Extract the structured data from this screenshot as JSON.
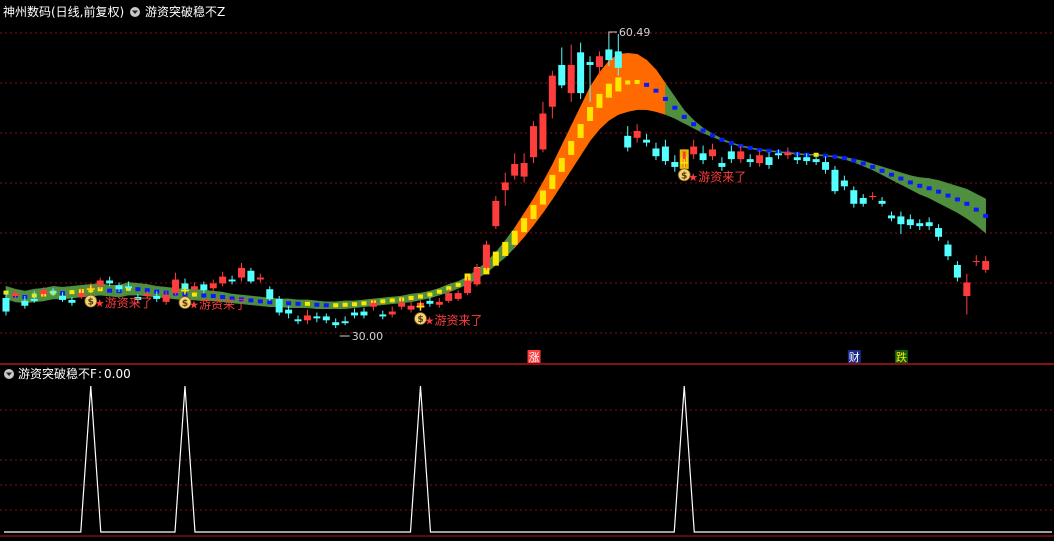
{
  "main_panel": {
    "stock_title": "神州数码(日线,前复权)",
    "indicator_title": "游资突破稳不Z",
    "signal_label": "游资来了",
    "high_label": "60.49",
    "low_label": "30.00",
    "markers": [
      "涨",
      "财",
      "跌"
    ]
  },
  "sub_panel": {
    "indicator_title": "游资突破稳不F",
    "indicator_value": "0.00"
  },
  "colors": {
    "up": "#ff3d3d",
    "down": "#54ffff",
    "band_hot": "#ff6a00",
    "band_cool": "#4f8f3f",
    "dash_hot": "#ffe600",
    "dash_cool": "#0a1aff",
    "signal_text": "#ff3d3d",
    "grid": "#8a1010"
  },
  "chart_data": [
    {
      "type": "candlestick",
      "price_high": 60.49,
      "price_low": 30.0,
      "candles": [
        {
          "o": 33.3,
          "c": 31.9,
          "h": 34.0,
          "l": 31.5
        },
        {
          "o": 33.5,
          "c": 33.8,
          "h": 34.1,
          "l": 33.2
        },
        {
          "o": 33.0,
          "c": 32.5,
          "h": 33.5,
          "l": 32.2
        },
        {
          "o": 33.2,
          "c": 33.0,
          "h": 34.0,
          "l": 32.8
        },
        {
          "o": 33.7,
          "c": 34.1,
          "h": 34.4,
          "l": 33.4
        },
        {
          "o": 34.0,
          "c": 33.8,
          "h": 34.3,
          "l": 33.5
        },
        {
          "o": 33.5,
          "c": 33.1,
          "h": 33.9,
          "l": 32.9
        },
        {
          "o": 33.1,
          "c": 32.8,
          "h": 33.4,
          "l": 32.5
        },
        {
          "o": 33.4,
          "c": 33.8,
          "h": 34.3,
          "l": 33.2
        },
        {
          "o": 34.1,
          "c": 34.4,
          "h": 34.8,
          "l": 33.8
        },
        {
          "o": 34.6,
          "c": 35.1,
          "h": 35.4,
          "l": 34.2
        },
        {
          "o": 35.1,
          "c": 34.8,
          "h": 35.5,
          "l": 34.5
        },
        {
          "o": 34.6,
          "c": 34.2,
          "h": 34.9,
          "l": 33.9
        },
        {
          "o": 34.5,
          "c": 34.3,
          "h": 35.0,
          "l": 34.0
        },
        {
          "o": 33.4,
          "c": 33.1,
          "h": 33.7,
          "l": 32.8
        },
        {
          "o": 33.5,
          "c": 33.7,
          "h": 34.0,
          "l": 33.2
        },
        {
          "o": 33.5,
          "c": 33.2,
          "h": 34.0,
          "l": 32.9
        },
        {
          "o": 32.9,
          "c": 33.6,
          "h": 34.0,
          "l": 32.6
        },
        {
          "o": 33.8,
          "c": 35.2,
          "h": 35.9,
          "l": 33.6
        },
        {
          "o": 34.8,
          "c": 34.2,
          "h": 35.3,
          "l": 33.9
        },
        {
          "o": 34.2,
          "c": 34.5,
          "h": 34.9,
          "l": 33.9
        },
        {
          "o": 34.7,
          "c": 34.1,
          "h": 35.0,
          "l": 33.8
        },
        {
          "o": 34.3,
          "c": 34.8,
          "h": 35.2,
          "l": 34.0
        },
        {
          "o": 34.8,
          "c": 35.5,
          "h": 36.0,
          "l": 34.5
        },
        {
          "o": 35.2,
          "c": 35.0,
          "h": 35.6,
          "l": 34.7
        },
        {
          "o": 35.4,
          "c": 36.4,
          "h": 36.9,
          "l": 35.0
        },
        {
          "o": 36.1,
          "c": 35.0,
          "h": 36.4,
          "l": 34.8
        },
        {
          "o": 35.2,
          "c": 35.4,
          "h": 35.8,
          "l": 34.9
        },
        {
          "o": 34.2,
          "c": 33.2,
          "h": 34.5,
          "l": 33.0
        },
        {
          "o": 33.2,
          "c": 31.8,
          "h": 33.5,
          "l": 31.5
        },
        {
          "o": 32.1,
          "c": 31.7,
          "h": 32.5,
          "l": 31.2
        },
        {
          "o": 31.1,
          "c": 30.9,
          "h": 31.5,
          "l": 30.6
        },
        {
          "o": 31.0,
          "c": 31.5,
          "h": 32.1,
          "l": 30.6
        },
        {
          "o": 31.4,
          "c": 31.2,
          "h": 31.8,
          "l": 30.8
        },
        {
          "o": 31.4,
          "c": 31.0,
          "h": 31.7,
          "l": 30.7
        },
        {
          "o": 30.8,
          "c": 30.5,
          "h": 31.2,
          "l": 30.2
        },
        {
          "o": 30.9,
          "c": 30.7,
          "h": 31.4,
          "l": 30.5
        },
        {
          "o": 31.8,
          "c": 31.5,
          "h": 32.2,
          "l": 31.2
        },
        {
          "o": 31.9,
          "c": 31.5,
          "h": 32.3,
          "l": 31.2
        },
        {
          "o": 32.4,
          "c": 32.8,
          "h": 33.2,
          "l": 32.0
        },
        {
          "o": 31.6,
          "c": 31.4,
          "h": 32.0,
          "l": 31.1
        },
        {
          "o": 31.6,
          "c": 31.9,
          "h": 32.4,
          "l": 31.3
        },
        {
          "o": 32.4,
          "c": 32.8,
          "h": 33.3,
          "l": 32.1
        },
        {
          "o": 32.1,
          "c": 32.5,
          "h": 33.0,
          "l": 31.8
        },
        {
          "o": 32.3,
          "c": 32.8,
          "h": 33.1,
          "l": 32.0
        },
        {
          "o": 33.0,
          "c": 32.7,
          "h": 33.4,
          "l": 32.4
        },
        {
          "o": 32.6,
          "c": 32.9,
          "h": 33.3,
          "l": 32.3
        },
        {
          "o": 33.0,
          "c": 33.8,
          "h": 34.2,
          "l": 32.8
        },
        {
          "o": 33.2,
          "c": 33.8,
          "h": 34.1,
          "l": 33.0
        },
        {
          "o": 33.8,
          "c": 35.1,
          "h": 35.5,
          "l": 33.6
        },
        {
          "o": 34.7,
          "c": 36.4,
          "h": 36.8,
          "l": 34.5
        },
        {
          "o": 36.4,
          "c": 38.8,
          "h": 39.2,
          "l": 36.2
        },
        {
          "o": 40.7,
          "c": 43.3,
          "h": 43.8,
          "l": 40.4
        },
        {
          "o": 44.4,
          "c": 45.2,
          "h": 46.2,
          "l": 42.8
        },
        {
          "o": 45.9,
          "c": 47.1,
          "h": 48.2,
          "l": 45.5
        },
        {
          "o": 45.8,
          "c": 47.2,
          "h": 48.2,
          "l": 45.2
        },
        {
          "o": 47.8,
          "c": 51.0,
          "h": 51.5,
          "l": 47.2
        },
        {
          "o": 48.6,
          "c": 52.3,
          "h": 53.5,
          "l": 48.3
        },
        {
          "o": 53.0,
          "c": 56.2,
          "h": 56.7,
          "l": 51.8
        },
        {
          "o": 57.3,
          "c": 55.2,
          "h": 59.1,
          "l": 54.9
        },
        {
          "o": 54.4,
          "c": 57.3,
          "h": 59.4,
          "l": 53.5
        },
        {
          "o": 58.6,
          "c": 54.4,
          "h": 59.6,
          "l": 53.8
        },
        {
          "o": 57.6,
          "c": 57.3,
          "h": 58.2,
          "l": 53.5
        },
        {
          "o": 57.1,
          "c": 58.2,
          "h": 58.7,
          "l": 56.3
        },
        {
          "o": 58.9,
          "c": 57.8,
          "h": 60.1,
          "l": 57.2
        },
        {
          "o": 58.7,
          "c": 57.0,
          "h": 60.49,
          "l": 56.2
        },
        {
          "o": 50.0,
          "c": 48.8,
          "h": 51.0,
          "l": 48.4
        },
        {
          "o": 49.8,
          "c": 50.5,
          "h": 51.2,
          "l": 49.3
        },
        {
          "o": 49.6,
          "c": 49.3,
          "h": 50.2,
          "l": 48.9
        },
        {
          "o": 48.7,
          "c": 47.9,
          "h": 49.3,
          "l": 47.5
        },
        {
          "o": 48.9,
          "c": 47.4,
          "h": 49.6,
          "l": 47.0
        },
        {
          "o": 47.3,
          "c": 46.8,
          "h": 48.0,
          "l": 46.3
        },
        {
          "o": 47.8,
          "c": 47.2,
          "h": 48.4,
          "l": 46.8
        },
        {
          "o": 48.1,
          "c": 48.9,
          "h": 49.6,
          "l": 47.6
        },
        {
          "o": 48.2,
          "c": 47.5,
          "h": 49.0,
          "l": 47.1
        },
        {
          "o": 47.9,
          "c": 48.6,
          "h": 49.2,
          "l": 47.5
        },
        {
          "o": 47.2,
          "c": 46.8,
          "h": 47.8,
          "l": 46.4
        },
        {
          "o": 48.4,
          "c": 47.6,
          "h": 49.0,
          "l": 47.2
        },
        {
          "o": 47.6,
          "c": 48.4,
          "h": 49.0,
          "l": 47.2
        },
        {
          "o": 47.6,
          "c": 47.3,
          "h": 48.1,
          "l": 46.8
        },
        {
          "o": 47.2,
          "c": 48.0,
          "h": 48.5,
          "l": 46.8
        },
        {
          "o": 47.8,
          "c": 47.0,
          "h": 48.3,
          "l": 46.6
        },
        {
          "o": 48.2,
          "c": 48.0,
          "h": 48.6,
          "l": 47.6
        },
        {
          "o": 48.0,
          "c": 48.3,
          "h": 48.8,
          "l": 47.6
        },
        {
          "o": 47.8,
          "c": 47.5,
          "h": 48.3,
          "l": 47.1
        },
        {
          "o": 47.8,
          "c": 47.4,
          "h": 48.2,
          "l": 47.0
        },
        {
          "o": 47.6,
          "c": 47.3,
          "h": 48.0,
          "l": 47.0
        },
        {
          "o": 47.3,
          "c": 46.5,
          "h": 47.9,
          "l": 46.1
        },
        {
          "o": 46.5,
          "c": 44.3,
          "h": 46.9,
          "l": 44.0
        },
        {
          "o": 45.4,
          "c": 44.8,
          "h": 45.9,
          "l": 44.4
        },
        {
          "o": 44.4,
          "c": 43.0,
          "h": 44.8,
          "l": 42.6
        },
        {
          "o": 43.6,
          "c": 43.0,
          "h": 44.0,
          "l": 42.7
        },
        {
          "o": 43.7,
          "c": 43.8,
          "h": 44.2,
          "l": 43.4
        },
        {
          "o": 43.3,
          "c": 43.0,
          "h": 43.7,
          "l": 42.7
        },
        {
          "o": 41.8,
          "c": 41.5,
          "h": 42.2,
          "l": 41.2
        },
        {
          "o": 41.7,
          "c": 40.9,
          "h": 42.2,
          "l": 39.9
        },
        {
          "o": 41.4,
          "c": 40.8,
          "h": 41.9,
          "l": 40.4
        },
        {
          "o": 41.0,
          "c": 40.7,
          "h": 41.4,
          "l": 40.3
        },
        {
          "o": 41.1,
          "c": 40.7,
          "h": 41.6,
          "l": 40.3
        },
        {
          "o": 40.5,
          "c": 39.6,
          "h": 40.9,
          "l": 39.2
        },
        {
          "o": 38.8,
          "c": 37.6,
          "h": 39.2,
          "l": 37.2
        },
        {
          "o": 36.7,
          "c": 35.4,
          "h": 37.1,
          "l": 35.0
        },
        {
          "o": 33.5,
          "c": 34.9,
          "h": 35.8,
          "l": 31.6
        },
        {
          "o": 37.0,
          "c": 37.1,
          "h": 37.7,
          "l": 36.6
        },
        {
          "o": 36.2,
          "c": 37.1,
          "h": 37.6,
          "l": 35.9
        }
      ],
      "band": {
        "upper": [
          34.5,
          34.2,
          34.0,
          34.2,
          34.3,
          34.5,
          34.4,
          34.5,
          34.6,
          34.7,
          34.8,
          34.6,
          34.6,
          34.9,
          34.8,
          34.7,
          34.5,
          34.4,
          34.3,
          34.2,
          34.2,
          34.1,
          34.0,
          33.9,
          33.7,
          33.6,
          33.5,
          33.4,
          33.3,
          33.2,
          33.2,
          33.1,
          33.1,
          33.0,
          32.9,
          32.9,
          33.0,
          33.0,
          33.1,
          33.2,
          33.3,
          33.4,
          33.5,
          33.7,
          33.8,
          34.0,
          34.3,
          34.7,
          35.0,
          35.5,
          36.2,
          37.0,
          38.0,
          39.2,
          40.5,
          42.0,
          43.5,
          45.2,
          47.0,
          49.0,
          51.0,
          53.0,
          55.0,
          56.5,
          57.7,
          58.4,
          58.5,
          58.4,
          57.8,
          56.8,
          55.4,
          54.0,
          52.6,
          51.6,
          50.8,
          50.2,
          49.7,
          49.3,
          49.0,
          48.8,
          48.6,
          48.5,
          48.4,
          48.3,
          48.2,
          48.1,
          48.1,
          48.0,
          47.9,
          47.8,
          47.6,
          47.4,
          47.1,
          46.8,
          46.5,
          46.2,
          45.9,
          45.7,
          45.6,
          45.4,
          45.1,
          44.8,
          44.5,
          44.0,
          43.5,
          43.0,
          42.5
        ],
        "lower": [
          33.2,
          32.9,
          32.8,
          32.9,
          33.0,
          33.2,
          33.2,
          33.3,
          33.4,
          33.5,
          33.6,
          33.5,
          33.4,
          33.6,
          33.6,
          33.5,
          33.4,
          33.3,
          33.2,
          33.1,
          33.1,
          33.0,
          33.0,
          32.9,
          32.8,
          32.7,
          32.6,
          32.5,
          32.4,
          32.4,
          32.3,
          32.3,
          32.3,
          32.2,
          32.2,
          32.2,
          32.2,
          32.3,
          32.4,
          32.5,
          32.6,
          32.7,
          32.8,
          32.9,
          33.1,
          33.3,
          33.6,
          33.9,
          34.3,
          34.7,
          35.3,
          35.9,
          36.7,
          37.5,
          38.5,
          39.6,
          40.8,
          42.1,
          43.5,
          45.0,
          46.5,
          48.0,
          49.5,
          50.7,
          51.6,
          52.2,
          52.5,
          52.7,
          52.7,
          52.5,
          52.2,
          51.8,
          51.3,
          50.8,
          50.3,
          49.9,
          49.5,
          49.2,
          48.9,
          48.7,
          48.5,
          48.4,
          48.3,
          48.2,
          48.1,
          48.0,
          48.0,
          47.9,
          47.8,
          47.6,
          47.3,
          46.9,
          46.5,
          46.0,
          45.5,
          45.0,
          44.5,
          44.0,
          43.6,
          43.1,
          42.6,
          42.1,
          41.5,
          40.8,
          40.0,
          39.2,
          38.3
        ]
      },
      "signal_bars": [
        9,
        19,
        44,
        72
      ],
      "special_bar": 72,
      "high_bar": 64,
      "low_bar": 35,
      "markers_at": [
        {
          "bar": 56,
          "text": "涨"
        },
        {
          "bar": 90,
          "text": "财"
        },
        {
          "bar": 95,
          "text": "跌"
        }
      ]
    },
    {
      "type": "line",
      "name": "游资突破稳不F",
      "spikes_at_bars": [
        9,
        19,
        44,
        72
      ],
      "value": 0.0
    }
  ]
}
